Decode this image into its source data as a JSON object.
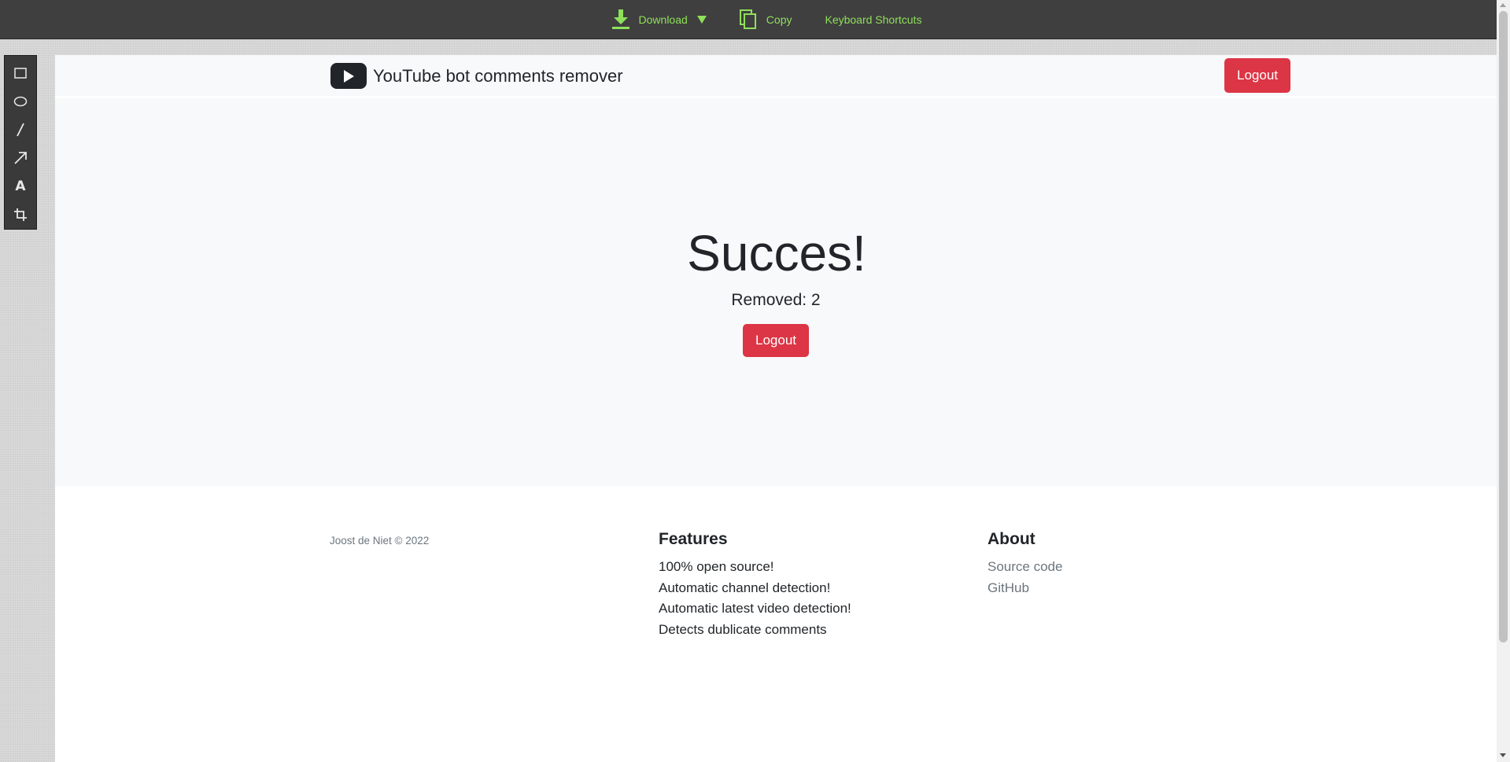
{
  "toolbar": {
    "download_label": "Download",
    "copy_label": "Copy",
    "shortcuts_label": "Keyboard Shortcuts",
    "accent_color": "#8ee05a"
  },
  "side_tools": [
    "rectangle-tool",
    "ellipse-tool",
    "line-tool",
    "arrow-tool",
    "text-tool",
    "crop-tool"
  ],
  "side_tools_text": "A",
  "header": {
    "brand_text": "YouTube bot comments remover",
    "logout_label": "Logout"
  },
  "hero": {
    "title": "Succes!",
    "removed_text": "Removed: 2",
    "logout_label": "Logout"
  },
  "footer": {
    "copyright": "Joost de Niet © 2022",
    "features_heading": "Features",
    "features": [
      "100% open source!",
      "Automatic channel detection!",
      "Automatic latest video detection!",
      "Detects dublicate comments"
    ],
    "about_heading": "About",
    "about_links": [
      "Source code",
      "GitHub"
    ]
  },
  "colors": {
    "danger": "#dc3545",
    "light_bg": "#f8f9fa",
    "text_dark": "#212529",
    "text_muted": "#6c757d"
  }
}
